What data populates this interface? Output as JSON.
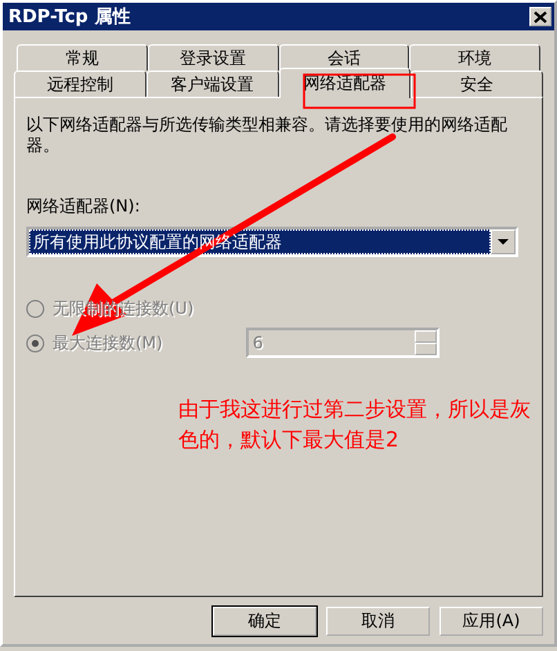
{
  "window": {
    "title": "RDP-Tcp 属性"
  },
  "tab_rows": [
    [
      {
        "label": "常规",
        "selected": false
      },
      {
        "label": "登录设置",
        "selected": false
      },
      {
        "label": "会话",
        "selected": false
      },
      {
        "label": "环境",
        "selected": false
      }
    ],
    [
      {
        "label": "远程控制",
        "selected": false
      },
      {
        "label": "客户端设置",
        "selected": false
      },
      {
        "label": "网络适配器",
        "selected": true
      },
      {
        "label": "安全",
        "selected": false
      }
    ]
  ],
  "panel": {
    "description": "以下网络适配器与所选传输类型相兼容。请选择要使用的网络适配器。",
    "adapter_label": "网络适配器(N):",
    "adapter_value": "所有使用此协议配置的网络适配器",
    "options": [
      {
        "label": "无限制的连接数(U)",
        "selected": false,
        "disabled": true
      },
      {
        "label": "最大连接数(M)",
        "selected": true,
        "disabled": true
      }
    ],
    "max_connections": {
      "value": "6",
      "disabled": true
    }
  },
  "annotation": {
    "text": "由于我这进行过第二步设置，所以是灰色的，默认下最大值是2"
  },
  "buttons": [
    {
      "label": "确定",
      "default": true
    },
    {
      "label": "取消",
      "default": false
    },
    {
      "label": "应用(A)",
      "default": false
    }
  ]
}
